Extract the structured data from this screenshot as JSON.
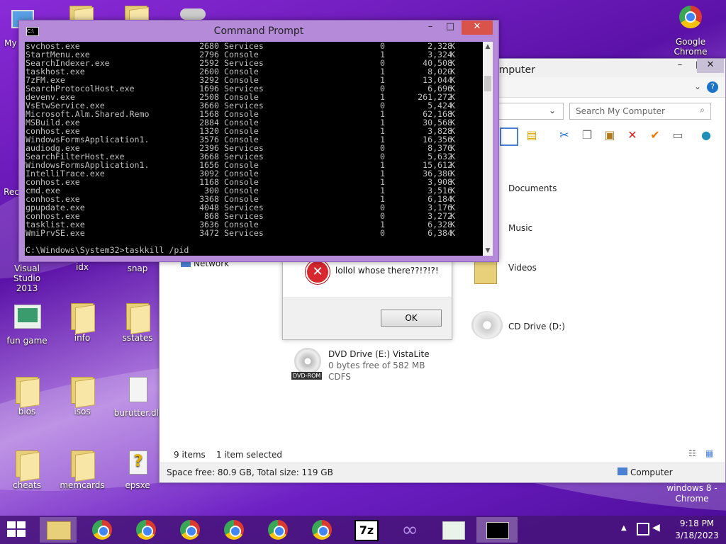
{
  "desktop": {
    "icons": [
      {
        "label": "My C"
      },
      {
        "label": "Visual Studio 2013"
      },
      {
        "label": "idx"
      },
      {
        "label": "snap"
      },
      {
        "label": "fun game"
      },
      {
        "label": "info"
      },
      {
        "label": "sstates"
      },
      {
        "label": "bios"
      },
      {
        "label": "isos"
      },
      {
        "label": "burutter.dll"
      },
      {
        "label": "cheats"
      },
      {
        "label": "memcards"
      },
      {
        "label": "epsxe"
      },
      {
        "label": "Google Chrome"
      },
      {
        "label": "Rec"
      }
    ],
    "watermark": "windows 8 - Chrome"
  },
  "cmd": {
    "title": "Command Prompt",
    "icon_text": "C:\\",
    "rows": [
      [
        "svchost.exe",
        "2680",
        "Services",
        "0",
        "2,328",
        "K"
      ],
      [
        "StartMenu.exe",
        "2796",
        "Console",
        "1",
        "3,324",
        "K"
      ],
      [
        "SearchIndexer.exe",
        "2592",
        "Services",
        "0",
        "40,508",
        "K"
      ],
      [
        "taskhost.exe",
        "2600",
        "Console",
        "1",
        "8,020",
        "K"
      ],
      [
        "7zFM.exe",
        "3292",
        "Console",
        "1",
        "13,044",
        "K"
      ],
      [
        "SearchProtocolHost.exe",
        "1696",
        "Services",
        "0",
        "6,696",
        "K"
      ],
      [
        "devenv.exe",
        "2508",
        "Console",
        "1",
        "261,272",
        "K"
      ],
      [
        "VsEtwService.exe",
        "3660",
        "Services",
        "0",
        "5,424",
        "K"
      ],
      [
        "Microsoft.Alm.Shared.Remo",
        "1568",
        "Console",
        "1",
        "62,168",
        "K"
      ],
      [
        "MSBuild.exe",
        "2884",
        "Console",
        "1",
        "30,568",
        "K"
      ],
      [
        "conhost.exe",
        "1320",
        "Console",
        "1",
        "3,828",
        "K"
      ],
      [
        "WindowsFormsApplication1.",
        "3576",
        "Console",
        "1",
        "16,356",
        "K"
      ],
      [
        "audiodg.exe",
        "2396",
        "Services",
        "0",
        "8,376",
        "K"
      ],
      [
        "SearchFilterHost.exe",
        "3668",
        "Services",
        "0",
        "5,632",
        "K"
      ],
      [
        "WindowsFormsApplication1.",
        "1656",
        "Console",
        "1",
        "15,612",
        "K"
      ],
      [
        "IntelliTrace.exe",
        "3092",
        "Console",
        "1",
        "36,380",
        "K"
      ],
      [
        "conhost.exe",
        "1168",
        "Console",
        "1",
        "3,908",
        "K"
      ],
      [
        "cmd.exe",
        "300",
        "Console",
        "1",
        "3,516",
        "K"
      ],
      [
        "conhost.exe",
        "3368",
        "Console",
        "1",
        "6,184",
        "K"
      ],
      [
        "gpupdate.exe",
        "4048",
        "Services",
        "0",
        "3,176",
        "K"
      ],
      [
        "conhost.exe",
        "868",
        "Services",
        "0",
        "3,272",
        "K"
      ],
      [
        "tasklist.exe",
        "3636",
        "Console",
        "1",
        "6,328",
        "K"
      ],
      [
        "WmiPrvSE.exe",
        "3472",
        "Services",
        "0",
        "6,384",
        "K"
      ]
    ],
    "prompt": "C:\\Windows\\System32>taskkill /pid"
  },
  "explorer": {
    "title": "omputer",
    "search_placeholder": "Search My Computer",
    "items": {
      "documents": "Documents",
      "music": "Music",
      "videos": "Videos",
      "network": "Network",
      "cd_drive": "CD Drive (D:)",
      "dvd_drive": "DVD Drive (E:) VistaLite",
      "dvd_free": "0 bytes free of 582 MB",
      "dvd_fs": "CDFS",
      "dvd_badge": "DVD-ROM"
    },
    "status": {
      "items": "9 items",
      "selected": "1 item selected",
      "space": "Space free: 80.9 GB, Total size: 119 GB",
      "location": "Computer"
    }
  },
  "message": {
    "text": "lollol whose there??!?!?!",
    "ok": "OK"
  },
  "taskbar": {
    "time": "9:18 PM",
    "date": "3/18/2023",
    "sevenzip": "7z"
  }
}
